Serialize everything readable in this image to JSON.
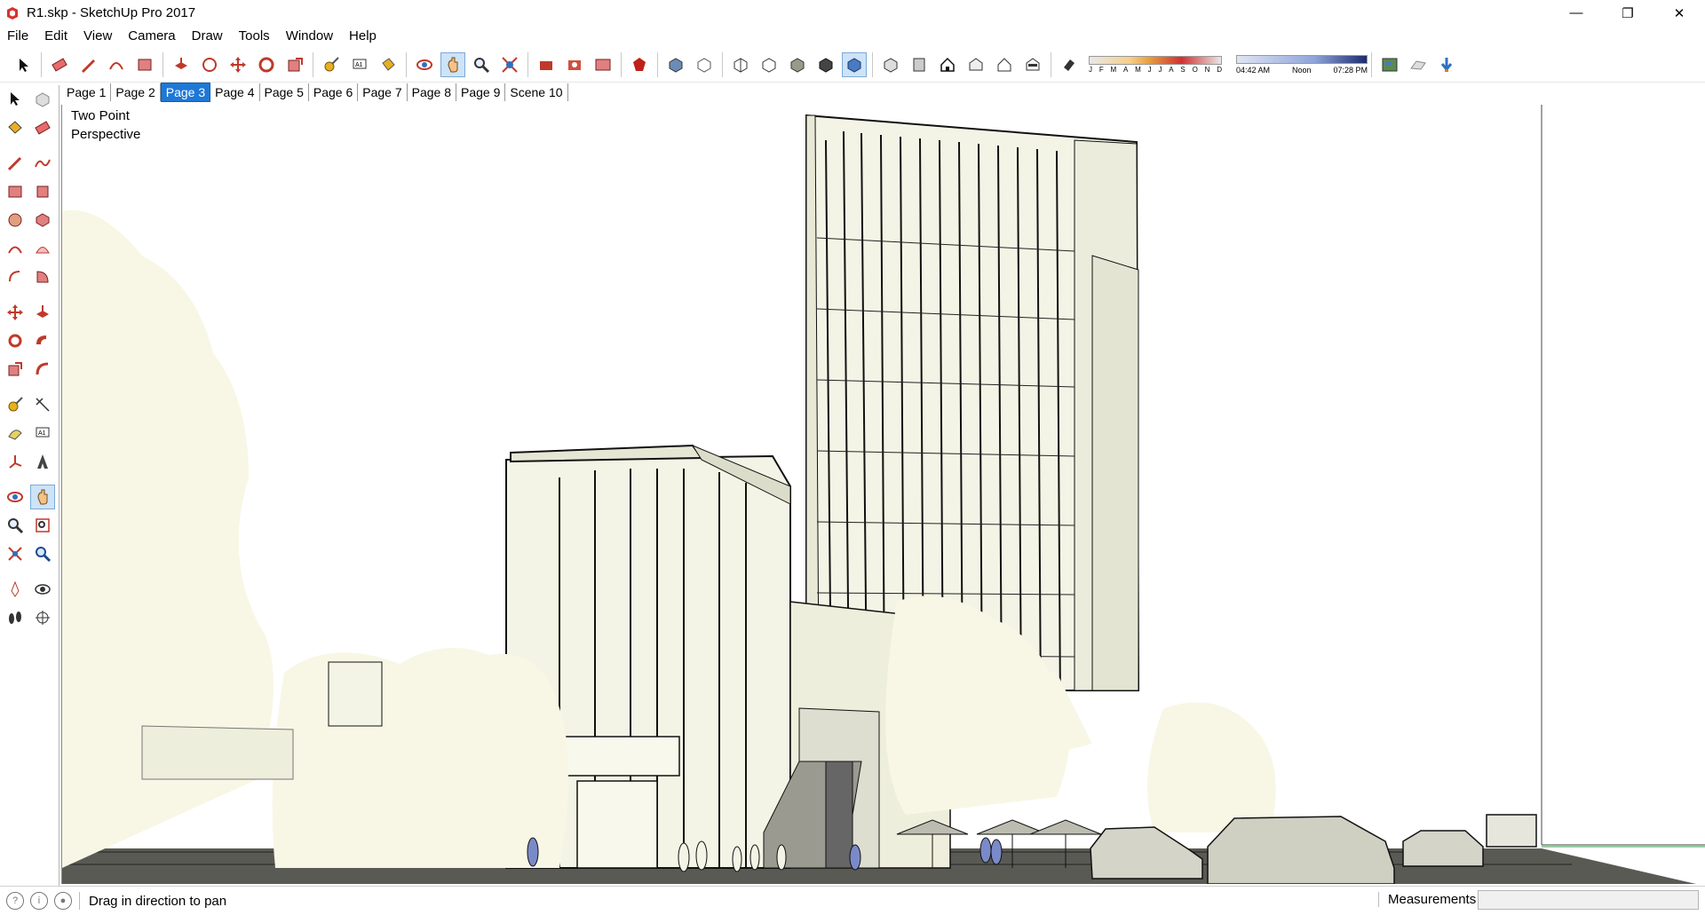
{
  "window": {
    "title": "R1.skp - SketchUp Pro 2017",
    "minimize_glyph": "—",
    "maximize_glyph": "❐",
    "close_glyph": "✕"
  },
  "menu": [
    "File",
    "Edit",
    "View",
    "Camera",
    "Draw",
    "Tools",
    "Window",
    "Help"
  ],
  "toolbar": {
    "months": [
      "J",
      "F",
      "M",
      "A",
      "M",
      "J",
      "J",
      "A",
      "S",
      "O",
      "N",
      "D"
    ],
    "time_start": "04:42 AM",
    "time_mid": "Noon",
    "time_end": "07:28 PM"
  },
  "tabs": [
    "Page 1",
    "Page 2",
    "Page 3",
    "Page 4",
    "Page 5",
    "Page 6",
    "Page 7",
    "Page 8",
    "Page 9",
    "Scene 10"
  ],
  "active_tab": "Page 3",
  "viewport": {
    "camera_label": "Two Point\nPerspective"
  },
  "status": {
    "message": "Drag in direction to pan",
    "measurements_label": "Measurements",
    "measurements_value": ""
  },
  "colors": {
    "accent": "#1e78d6",
    "model_fill": "#f4f4e6",
    "tree_fill": "#f8f7e6"
  }
}
